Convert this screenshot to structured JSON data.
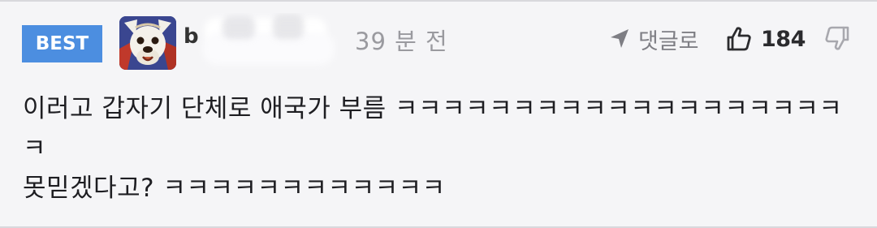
{
  "comment": {
    "badge": "BEST",
    "username": "b",
    "timestamp": "39 분 전",
    "reply_label": "댓글로",
    "like_count": "184",
    "body_lines": [
      "이러고 갑자기 단체로 애국가 부름 ㅋㅋㅋㅋㅋㅋㅋㅋㅋㅋㅋㅋㅋㅋㅋㅋㅋㅋㅋ",
      "ㅋ",
      "못믿겠다고? ㅋㅋㅋㅋㅋㅋㅋㅋㅋㅋㅋㅋ"
    ]
  },
  "colors": {
    "badge_bg": "#4c8ee0",
    "background": "#f5f5f7",
    "timestamp": "#9a9a9f",
    "icon_gray": "#7e7e84"
  },
  "icons": {
    "reply": "navigation-arrow-icon",
    "like": "thumbs-up-icon",
    "dislike": "thumbs-down-icon"
  }
}
